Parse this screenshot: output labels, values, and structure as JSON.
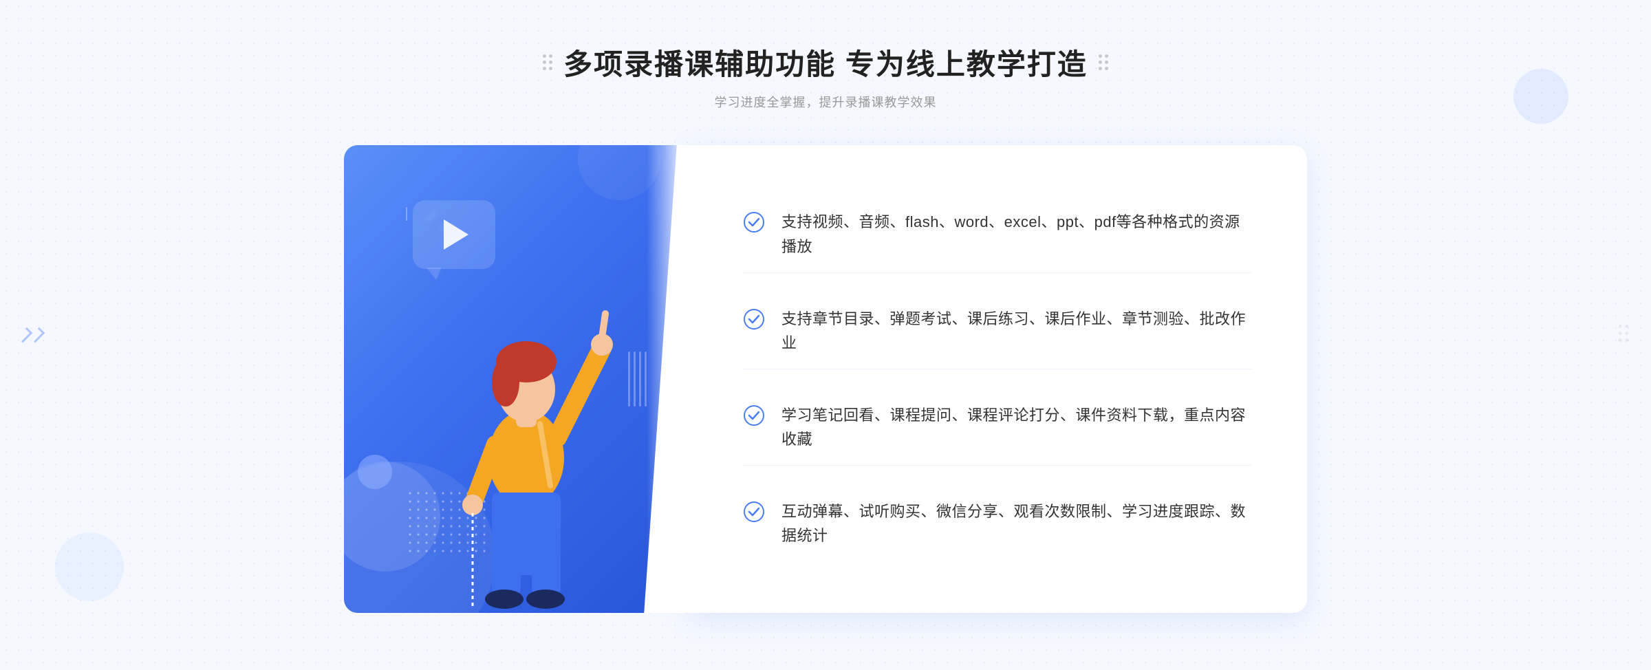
{
  "header": {
    "title": "多项录播课辅助功能 专为线上教学打造",
    "subtitle": "学习进度全掌握，提升录播课教学效果",
    "dots_left": "decorative-dots",
    "dots_right": "decorative-dots"
  },
  "features": [
    {
      "id": "feature-1",
      "text": "支持视频、音频、flash、word、excel、ppt、pdf等各种格式的资源播放",
      "check": "check-circle-icon"
    },
    {
      "id": "feature-2",
      "text": "支持章节目录、弹题考试、课后练习、课后作业、章节测验、批改作业",
      "check": "check-circle-icon"
    },
    {
      "id": "feature-3",
      "text": "学习笔记回看、课程提问、课程评论打分、课件资料下载，重点内容收藏",
      "check": "check-circle-icon"
    },
    {
      "id": "feature-4",
      "text": "互动弹幕、试听购买、微信分享、观看次数限制、学习进度跟踪、数据统计",
      "check": "check-circle-icon"
    }
  ],
  "illustration": {
    "play_button_alt": "play-button",
    "person_alt": "teacher-pointing-figure"
  },
  "colors": {
    "accent_blue": "#4a7ef5",
    "dark_blue": "#2855d8",
    "light_blue": "#5b8ff9",
    "text_dark": "#222222",
    "text_medium": "#333333",
    "text_light": "#999999",
    "bg": "#f5f8ff"
  }
}
